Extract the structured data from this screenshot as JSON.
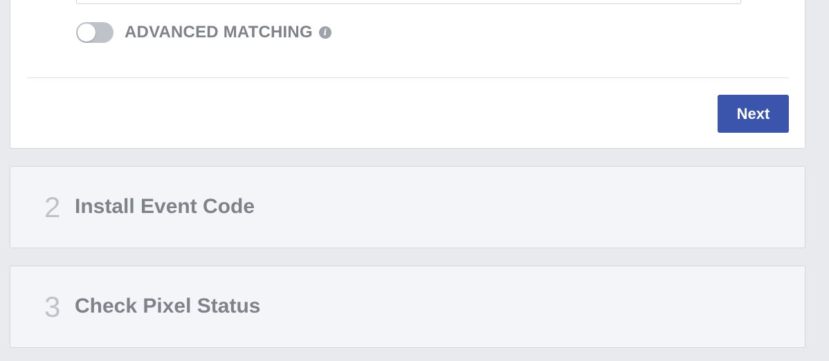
{
  "step1": {
    "advanced_matching": {
      "label": "ADVANCED MATCHING",
      "enabled": false,
      "info_icon": "info-icon"
    },
    "next_label": "Next"
  },
  "steps": [
    {
      "number": "2",
      "title": "Install Event Code"
    },
    {
      "number": "3",
      "title": "Check Pixel Status"
    }
  ],
  "colors": {
    "primary_button": "#3b55ad",
    "page_background": "#e9eaed",
    "muted_text": "#7f8289"
  }
}
